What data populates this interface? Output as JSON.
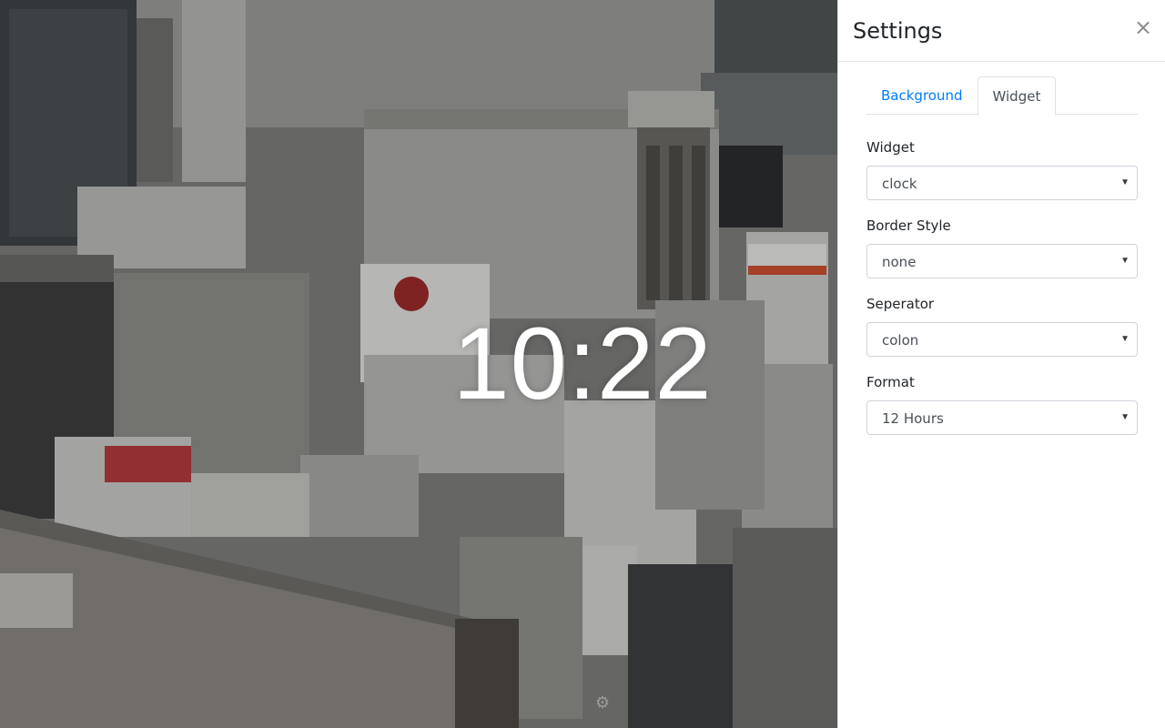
{
  "clock": {
    "time": "10:22"
  },
  "settings": {
    "title": "Settings",
    "close_symbol": "×",
    "tabs": [
      {
        "label": "Background",
        "active": false
      },
      {
        "label": "Widget",
        "active": true
      }
    ],
    "fields": [
      {
        "label": "Widget",
        "value": "clock"
      },
      {
        "label": "Border Style",
        "value": "none"
      },
      {
        "label": "Seperator",
        "value": "colon"
      },
      {
        "label": "Format",
        "value": "12 Hours"
      }
    ]
  },
  "icons": {
    "close": "close-icon",
    "dropdown": "chevron-down-icon",
    "settings": "gear-icon"
  },
  "colors": {
    "tab_link": "#007bff",
    "panel_bg": "#ffffff",
    "clock_text": "#ffffff"
  }
}
